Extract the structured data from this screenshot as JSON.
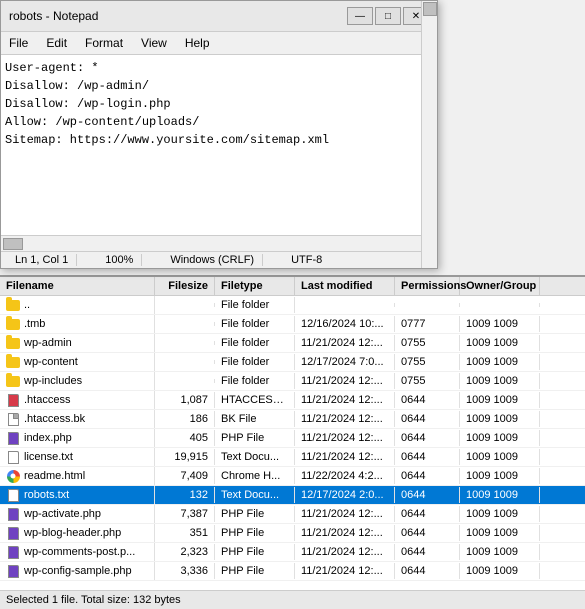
{
  "notepad": {
    "title": "robots - Notepad",
    "menubar": [
      "File",
      "Edit",
      "Format",
      "View",
      "Help"
    ],
    "content_lines": [
      "User-agent: *",
      "Disallow: /wp-admin/",
      "Disallow: /wp-login.php",
      "Allow: /wp-content/uploads/",
      "Sitemap: https://www.yoursite.com/sitemap.xml"
    ],
    "statusbar": {
      "position": "Ln 1, Col 1",
      "zoom": "100%",
      "line_endings": "Windows (CRLF)",
      "encoding": "UTF-8"
    },
    "titlebar_buttons": {
      "minimize": "—",
      "maximize": "□",
      "close": "✕"
    }
  },
  "filemanager": {
    "columns": [
      "Filename",
      "Filesize",
      "Filetype",
      "Last modified",
      "Permissions",
      "Owner/Group"
    ],
    "files": [
      {
        "name": "..",
        "size": "",
        "type": "File folder",
        "modified": "",
        "permissions": "",
        "owner": "",
        "icon": "parent"
      },
      {
        "name": ".tmb",
        "size": "",
        "type": "File folder",
        "modified": "12/16/2024 10:...",
        "permissions": "0777",
        "owner": "1009 1009",
        "icon": "folder"
      },
      {
        "name": "wp-admin",
        "size": "",
        "type": "File folder",
        "modified": "11/21/2024 12:...",
        "permissions": "0755",
        "owner": "1009 1009",
        "icon": "folder"
      },
      {
        "name": "wp-content",
        "size": "",
        "type": "File folder",
        "modified": "12/17/2024 7:0...",
        "permissions": "0755",
        "owner": "1009 1009",
        "icon": "folder"
      },
      {
        "name": "wp-includes",
        "size": "",
        "type": "File folder",
        "modified": "11/21/2024 12:...",
        "permissions": "0755",
        "owner": "1009 1009",
        "icon": "folder"
      },
      {
        "name": ".htaccess",
        "size": "1,087",
        "type": "HTACCESS ...",
        "modified": "11/21/2024 12:...",
        "permissions": "0644",
        "owner": "1009 1009",
        "icon": "htaccess"
      },
      {
        "name": ".htaccess.bk",
        "size": "186",
        "type": "BK File",
        "modified": "11/21/2024 12:...",
        "permissions": "0644",
        "owner": "1009 1009",
        "icon": "file"
      },
      {
        "name": "index.php",
        "size": "405",
        "type": "PHP File",
        "modified": "11/21/2024 12:...",
        "permissions": "0644",
        "owner": "1009 1009",
        "icon": "php"
      },
      {
        "name": "license.txt",
        "size": "19,915",
        "type": "Text Docu...",
        "modified": "11/21/2024 12:...",
        "permissions": "0644",
        "owner": "1009 1009",
        "icon": "txt"
      },
      {
        "name": "readme.html",
        "size": "7,409",
        "type": "Chrome H...",
        "modified": "11/22/2024 4:2...",
        "permissions": "0644",
        "owner": "1009 1009",
        "icon": "chrome"
      },
      {
        "name": "robots.txt",
        "size": "132",
        "type": "Text Docu...",
        "modified": "12/17/2024 2:0...",
        "permissions": "0644",
        "owner": "1009 1009",
        "icon": "txt",
        "selected": true
      },
      {
        "name": "wp-activate.php",
        "size": "7,387",
        "type": "PHP File",
        "modified": "11/21/2024 12:...",
        "permissions": "0644",
        "owner": "1009 1009",
        "icon": "php"
      },
      {
        "name": "wp-blog-header.php",
        "size": "351",
        "type": "PHP File",
        "modified": "11/21/2024 12:...",
        "permissions": "0644",
        "owner": "1009 1009",
        "icon": "php"
      },
      {
        "name": "wp-comments-post.p...",
        "size": "2,323",
        "type": "PHP File",
        "modified": "11/21/2024 12:...",
        "permissions": "0644",
        "owner": "1009 1009",
        "icon": "php"
      },
      {
        "name": "wp-config-sample.php",
        "size": "3,336",
        "type": "PHP File",
        "modified": "11/21/2024 12:...",
        "permissions": "0644",
        "owner": "1009 1009",
        "icon": "php"
      }
    ],
    "statusbar": "Selected 1 file. Total size: 132 bytes"
  }
}
